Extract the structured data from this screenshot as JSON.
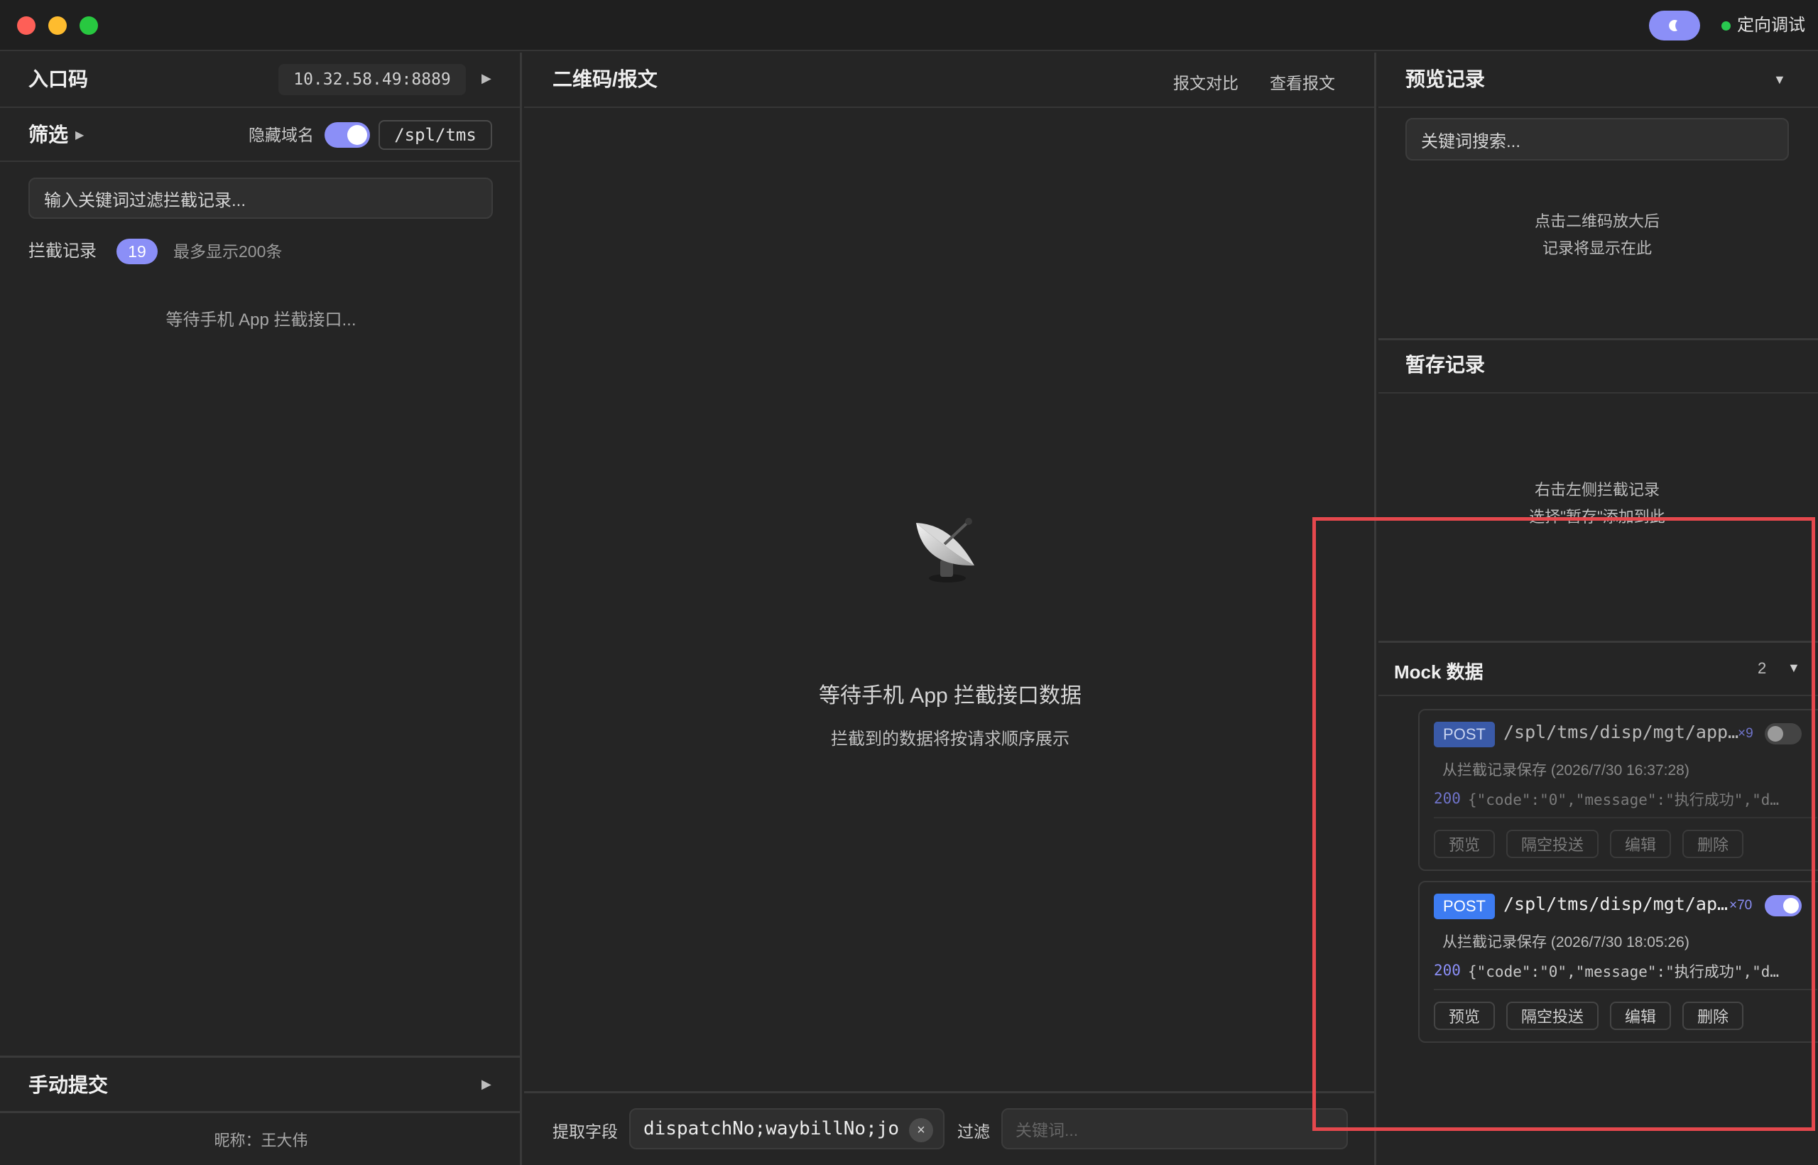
{
  "titlebar": {
    "debug_label": "定向调试",
    "theme_icon": "moon-icon",
    "colors": {
      "close": "#fe5f57",
      "minimize": "#febc2e",
      "maximize": "#28c840",
      "accent": "#8b8ff7",
      "status": "#29c950"
    }
  },
  "left": {
    "entry_title": "入口码",
    "entry_address": "10.32.58.49:8889",
    "filter_title": "筛选",
    "hide_domain_label": "隐藏域名",
    "hide_domain_on": true,
    "path_prefix": "/spl/tms",
    "search_placeholder": "输入关键词过滤拦截记录...",
    "records_label": "拦截记录",
    "records_count": "19",
    "records_limit": "最多显示200条",
    "waiting_text": "等待手机 App 拦截接口...",
    "manual_title": "手动提交",
    "nickname": "昵称：王大伟"
  },
  "middle": {
    "title": "二维码/报文",
    "compare_label": "报文对比",
    "view_label": "查看报文",
    "empty_icon": "satellite-dish-icon",
    "empty_title": "等待手机 App 拦截接口数据",
    "empty_sub": "拦截到的数据将按请求顺序展示",
    "extract_label": "提取字段",
    "extract_value": "dispatchNo;waybillNo;jo",
    "filter_label": "过滤",
    "filter_placeholder": "关键词..."
  },
  "right": {
    "preview_title": "预览记录",
    "preview_search_placeholder": "关键词搜索...",
    "preview_empty_1": "点击二维码放大后",
    "preview_empty_2": "记录将显示在此",
    "stash_title": "暂存记录",
    "stash_empty_1": "右击左侧拦截记录",
    "stash_empty_2": "选择\"暂存\"添加到此",
    "mock_title": "Mock 数据",
    "mock_count": "2",
    "mocks": [
      {
        "method": "POST",
        "path": "/spl/tms/disp/mgt/app…",
        "hits": "×9",
        "enabled": false,
        "source": "从拦截记录保存 (2026/7/30 16:37:28)",
        "status": "200",
        "body": "{\"code\":\"0\",\"message\":\"执行成功\",\"d…",
        "actions": [
          "预览",
          "隔空投送",
          "编辑",
          "删除"
        ]
      },
      {
        "method": "POST",
        "path": "/spl/tms/disp/mgt/ap…",
        "hits": "×70",
        "enabled": true,
        "source": "从拦截记录保存 (2026/7/30 18:05:26)",
        "status": "200",
        "body": "{\"code\":\"0\",\"message\":\"执行成功\",\"d…",
        "actions": [
          "预览",
          "隔空投送",
          "编辑",
          "删除"
        ]
      }
    ]
  }
}
